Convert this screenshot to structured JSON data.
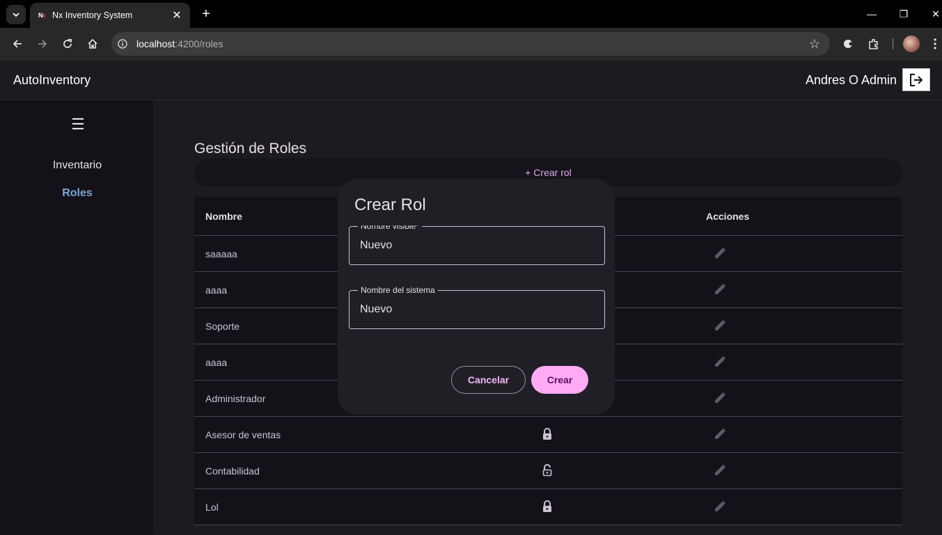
{
  "browser": {
    "tab_title": "Nx Inventory System",
    "favicon_text": "N",
    "url_host": "localhost",
    "url_path": ":4200/roles"
  },
  "app": {
    "brand": "AutoInventory",
    "user": "Andres O Admin"
  },
  "sidebar": {
    "items": [
      {
        "label": "Inventario"
      },
      {
        "label": "Roles"
      }
    ]
  },
  "page": {
    "title": "Gestión de Roles",
    "create_link": "+ Crear rol"
  },
  "table": {
    "headers": {
      "name": "Nombre",
      "actions": "Acciones"
    },
    "rows": [
      {
        "name": "saaaaa",
        "lock": ""
      },
      {
        "name": "aaaa",
        "lock": ""
      },
      {
        "name": "Soporte",
        "lock": ""
      },
      {
        "name": "aaaa",
        "lock": ""
      },
      {
        "name": "Administrador",
        "lock": ""
      },
      {
        "name": "Asesor de ventas",
        "lock": "locked"
      },
      {
        "name": "Contabilidad",
        "lock": "unlocked"
      },
      {
        "name": "Lol",
        "lock": "locked"
      }
    ]
  },
  "dialog": {
    "title": "Crear Rol",
    "fields": [
      {
        "label": "Nombre visible*",
        "value": "Nuevo"
      },
      {
        "label": "Nombre del sistema",
        "value": "Nuevo"
      }
    ],
    "cancel_label": "Cancelar",
    "create_label": "Crear"
  },
  "colors": {
    "accent": "#ffaaf5",
    "active_nav": "#7aa7d6",
    "surface": "#1d1b20"
  }
}
